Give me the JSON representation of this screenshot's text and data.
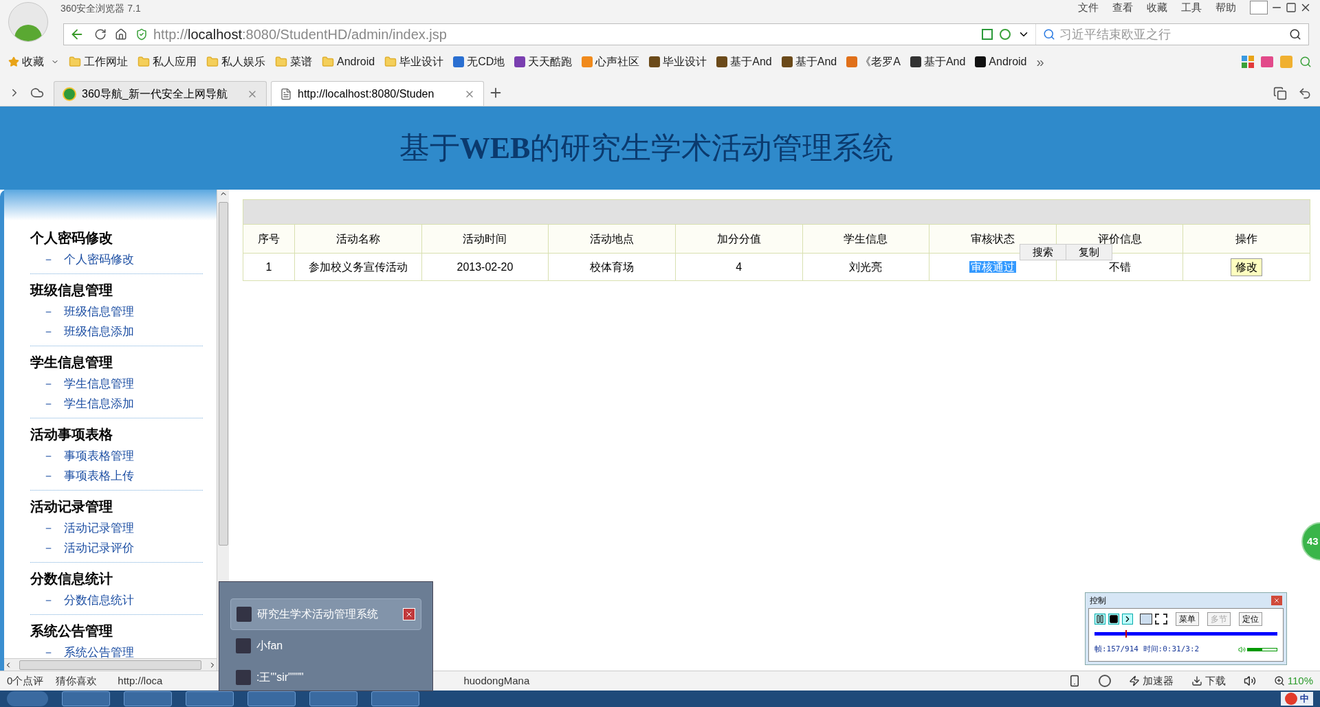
{
  "browser": {
    "title": "360安全浏览器 7.1",
    "menu": [
      "文件",
      "查看",
      "收藏",
      "工具",
      "帮助"
    ],
    "address": {
      "scheme": "http://",
      "host": "localhost",
      "rest": ":8080/StudentHD/admin/index.jsp"
    },
    "search": {
      "placeholder": "习近平结束欧亚之行"
    },
    "bookmarks": [
      {
        "kind": "star",
        "label": "收藏"
      },
      {
        "kind": "folder",
        "label": "工作网址"
      },
      {
        "kind": "folder",
        "label": "私人应用"
      },
      {
        "kind": "folder",
        "label": "私人娱乐"
      },
      {
        "kind": "folder",
        "label": "菜谱"
      },
      {
        "kind": "folder",
        "label": "Android"
      },
      {
        "kind": "folder",
        "label": "毕业设计"
      },
      {
        "kind": "site",
        "label": "无CD地",
        "color": "#2a6fd1"
      },
      {
        "kind": "site",
        "label": "天天酷跑",
        "color": "#7a3fb0"
      },
      {
        "kind": "site",
        "label": "心声社区",
        "color": "#f08a1c"
      },
      {
        "kind": "site",
        "label": "毕业设计",
        "color": "#6b4a1a"
      },
      {
        "kind": "site",
        "label": "基于And",
        "color": "#6b4a1a"
      },
      {
        "kind": "site",
        "label": "基于And",
        "color": "#6b4a1a"
      },
      {
        "kind": "site",
        "label": "《老罗A",
        "color": "#e0701a"
      },
      {
        "kind": "site",
        "label": "基于And",
        "color": "#333333"
      },
      {
        "kind": "site",
        "label": "Android",
        "color": "#111111"
      }
    ],
    "more": "»",
    "tabs": [
      {
        "label": "360导航_新一代安全上网导航",
        "selected": false
      },
      {
        "label": "http://localhost:8080/Studen",
        "selected": true
      }
    ]
  },
  "page": {
    "title": "基于**WEB**的研究生学术活动管理系统",
    "sidebar": [
      {
        "title": "个人密码修改",
        "items": [
          "个人密码修改"
        ]
      },
      {
        "title": "班级信息管理",
        "items": [
          "班级信息管理",
          "班级信息添加"
        ]
      },
      {
        "title": "学生信息管理",
        "items": [
          "学生信息管理",
          "学生信息添加"
        ]
      },
      {
        "title": "活动事项表格",
        "items": [
          "事项表格管理",
          "事项表格上传"
        ]
      },
      {
        "title": "活动记录管理",
        "items": [
          "活动记录管理",
          "活动记录评价"
        ]
      },
      {
        "title": "分数信息统计",
        "items": [
          "分数信息统计"
        ]
      },
      {
        "title": "系统公告管理",
        "items": [
          "系统公告管理"
        ]
      }
    ],
    "item_dash": "－",
    "table": {
      "columns": [
        "序号",
        "活动名称",
        "活动时间",
        "活动地点",
        "加分分值",
        "学生信息",
        "审核状态",
        "评价信息",
        "操作"
      ],
      "rows": [
        {
          "cells": [
            {
              "kind": "text",
              "text": "1",
              "selected": false
            },
            {
              "kind": "text",
              "text": "参加校义务宣传活动",
              "selected": false
            },
            {
              "kind": "text",
              "text": "2013-02-20",
              "selected": false
            },
            {
              "kind": "text",
              "text": "校体育场",
              "selected": false
            },
            {
              "kind": "text",
              "text": "4",
              "selected": false
            },
            {
              "kind": "text",
              "text": "刘光亮",
              "selected": false
            },
            {
              "kind": "text",
              "text": "审核通过",
              "selected": true
            },
            {
              "kind": "text",
              "text": "不错",
              "selected": false
            },
            {
              "kind": "button",
              "text": "修改"
            }
          ]
        }
      ]
    },
    "context_menu": [
      "搜索",
      "复制"
    ]
  },
  "taskbar_popup": [
    {
      "label": "研究生学术活动管理系统",
      "selected": true
    },
    {
      "label": "小fan",
      "selected": false
    },
    {
      "label": ":王\"'sir\"\"\"\"",
      "selected": false
    }
  ],
  "recorder": {
    "title": "控制",
    "buttons": [
      {
        "label": "菜单",
        "disabled": false
      },
      {
        "label": "多节",
        "disabled": true
      },
      {
        "label": "定位",
        "disabled": false
      }
    ],
    "progress": {
      "level": 0.17
    },
    "status": "帧:157/914 时间:0:31/3:2",
    "volume": {
      "level": 0.5
    }
  },
  "side_badge": "43",
  "status_bar": {
    "left": [
      "0个点评",
      "猜你喜欢"
    ],
    "url_start": "http://loca",
    "url_end": "huodongMana",
    "right": [
      "加速器",
      "下载"
    ],
    "zoom": "110%"
  },
  "tray": {
    "ime": "中"
  }
}
